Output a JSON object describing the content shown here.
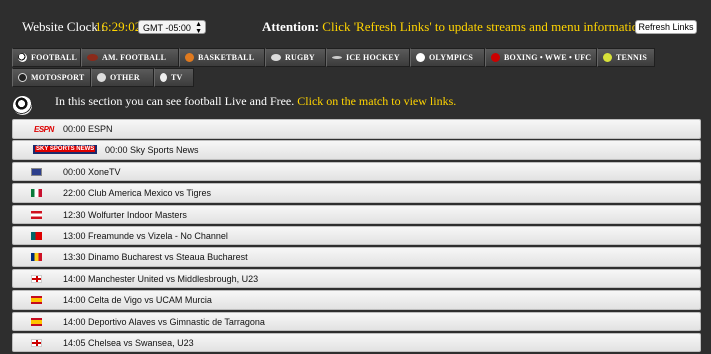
{
  "header": {
    "clock_label": "Website Clock :",
    "clock_time": "16:29:02",
    "timezone": "GMT -05:00",
    "attention_label": "Attention:",
    "attention_text": "Click 'Refresh Links' to update streams and menu information",
    "refresh_button": "Refresh Links"
  },
  "nav": {
    "row1": [
      {
        "label": "FOOTBALL",
        "icon": "football-icon"
      },
      {
        "label": "AM. FOOTBALL",
        "icon": "american-football-icon"
      },
      {
        "label": "BASKETBALL",
        "icon": "basketball-icon"
      },
      {
        "label": "RUGBY",
        "icon": "rugby-ball-icon"
      },
      {
        "label": "ICE HOCKEY",
        "icon": "hockey-stick-icon"
      },
      {
        "label": "OLYMPICS",
        "icon": "olympics-icon"
      },
      {
        "label": "BOXING • WWE • UFC",
        "icon": "boxing-glove-icon"
      },
      {
        "label": "TENNIS",
        "icon": "tennis-ball-icon"
      }
    ],
    "row2": [
      {
        "label": "MOTOSPORT",
        "icon": "tire-icon"
      },
      {
        "label": "OTHER",
        "icon": "other-icon"
      },
      {
        "label": "TV",
        "icon": "tv-icon"
      }
    ]
  },
  "intro": {
    "text": "In this section you can see football Live and Free.",
    "link_text": "Click on the match to view links."
  },
  "matches": [
    {
      "time_title": "00:00 ESPN",
      "logo": "ESPN"
    },
    {
      "time_title": "00:00 Sky Sports News",
      "logo": "SKY SPORTS NEWS"
    },
    {
      "time_title": "00:00 XoneTV",
      "flag": "xone"
    },
    {
      "time_title": "22:00 Club America Mexico vs Tigres",
      "flag": "mexico"
    },
    {
      "time_title": "12:30 Wolfurter Indoor Masters",
      "flag": "austria"
    },
    {
      "time_title": "13:00 Freamunde vs Vizela - No Channel",
      "flag": "portugal"
    },
    {
      "time_title": "13:30 Dinamo Bucharest vs Steaua Bucharest",
      "flag": "romania"
    },
    {
      "time_title": "14:00 Manchester United vs Middlesbrough, U23",
      "flag": "england"
    },
    {
      "time_title": "14:00 Celta de Vigo vs UCAM Murcia",
      "flag": "spain"
    },
    {
      "time_title": "14:00 Deportivo Alaves vs Gimnastic de Tarragona",
      "flag": "spain"
    },
    {
      "time_title": "14:05 Chelsea vs Swansea, U23",
      "flag": "england"
    }
  ],
  "colors": {
    "accent_yellow": "#ffd400",
    "background": "#2e2e2e"
  }
}
